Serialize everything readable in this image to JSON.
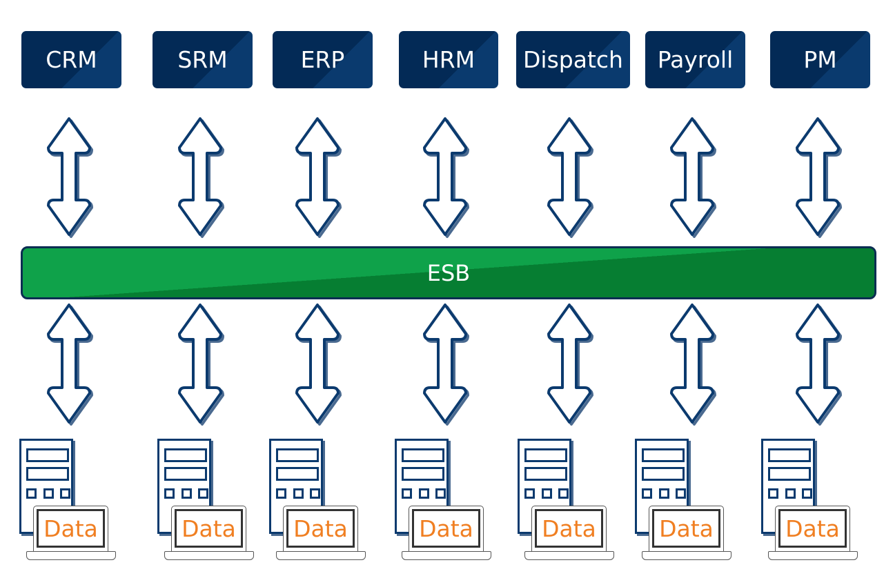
{
  "systems": [
    {
      "label": "CRM"
    },
    {
      "label": "SRM"
    },
    {
      "label": "ERP"
    },
    {
      "label": "HRM"
    },
    {
      "label": "Dispatch"
    },
    {
      "label": "Payroll"
    },
    {
      "label": "PM"
    }
  ],
  "bus": {
    "label": "ESB"
  },
  "data_label": "Data",
  "colors": {
    "system_box": "#032a56",
    "bus": "#0fa24a",
    "arrow_outline": "#0b3a6e",
    "data_text": "#f07f22"
  },
  "icons": {
    "connector": "double-arrow-icon",
    "store": "server-icon",
    "client": "laptop-icon"
  }
}
